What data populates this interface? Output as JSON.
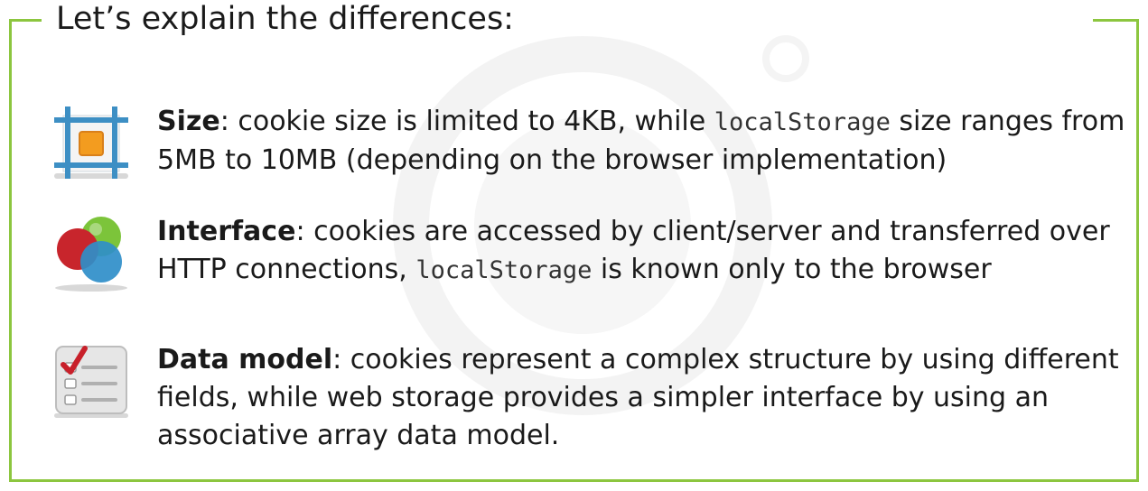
{
  "title": "Let’s explain the differences:",
  "colors": {
    "frame": "#8cc63f",
    "text": "#1a1a1a"
  },
  "items": [
    {
      "icon": "size-frame-icon",
      "heading": "Size",
      "text_before": ": cookie size is limited to 4KB, while ",
      "code": "localStorage",
      "text_after": " size ranges from 5MB to 10MB (depending on the browser implementation)"
    },
    {
      "icon": "interface-circles-icon",
      "heading": "Interface",
      "text_before": ": cookies are accessed by client/server and transferred over HTTP connections, ",
      "code": "localStorage",
      "text_after": " is known only to the browser"
    },
    {
      "icon": "checklist-icon",
      "heading": "Data model",
      "text_before": ": cookies represent a complex structure by using different fields, while web storage provides a simpler interface by using an associative array data model.",
      "code": "",
      "text_after": ""
    }
  ]
}
